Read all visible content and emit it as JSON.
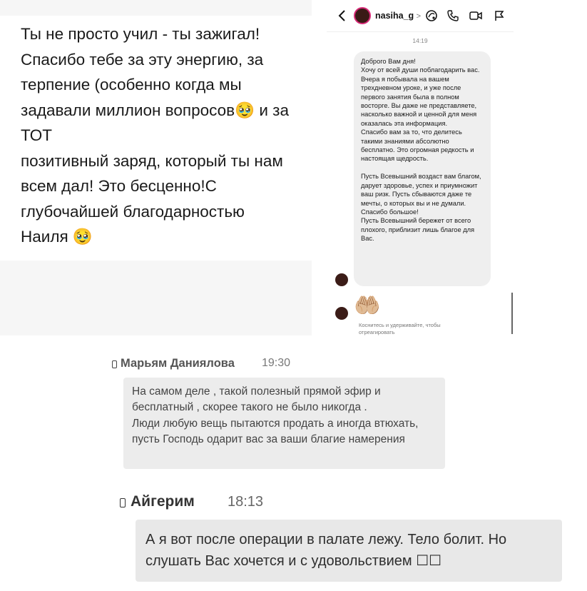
{
  "note": {
    "text": "Ты не просто учил - ты зажигал! Спасибо тебе за эту энергию, за терпение (особенно когда мы задавали миллион вопросов🥹 и за ТОТ\nпозитивный заряд, который ты нам всем дал! Это бесценно!С глубочайшей благодарностью\nНаиля 🥹"
  },
  "instagram": {
    "username": "nasiha_g",
    "chevron": ">",
    "time": "14:19",
    "message": "Доброго Вам дня!\nХочу от всей души поблагодарить вас. Вчера я побывала на вашем трехдневном уроке, и уже после первого занятия была в полном восторге. Вы даже не представляете, насколько важной и ценной для меня оказалась эта информация.\nСпасибо вам за то, что делитесь такими знаниями абсолютно бесплатно. Это огромная редкость и настоящая щедрость.\n\nПусть Всевышний воздаст вам благом, дарует здоровье, успех и приумножит ваш ризк. Пусть сбываются даже те мечты, о которых вы и не думали.\nСпасибо большое!\nПусть Всевышний бережет от всего плохого, приблизит лишь благое для Вас.",
    "reaction_emoji": "🤲🏼",
    "hint": "Коснитесь и удерживайте, чтобы отреагировать",
    "icons": [
      "back-icon",
      "voice-chat-icon",
      "phone-icon",
      "video-icon",
      "flag-icon"
    ]
  },
  "message1": {
    "author": "Марьям Даниялова",
    "time": "19:30",
    "text": "На самом деле , такой полезный прямой эфир и бесплатный , скорее такого не было никогда .\nЛюди любую вещь пытаются продать а иногда втюхать, пусть Господь одарит вас за ваши благие намерения"
  },
  "message2": {
    "author": "Айгерим",
    "time": "18:13",
    "text": "А я вот после операции в палате лежу. Тело болит. Но слушать Вас хочется и с удовольствием ☐☐"
  }
}
